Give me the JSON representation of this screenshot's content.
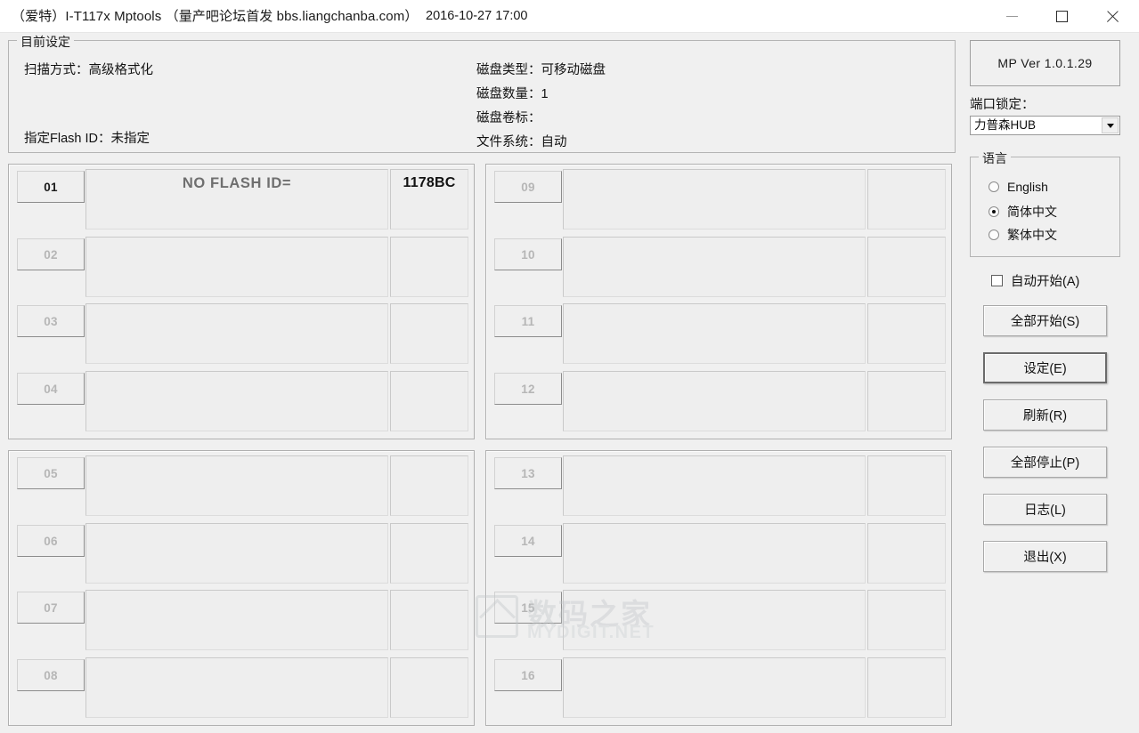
{
  "window": {
    "title": "（爱特）I-T117x Mptools （量产吧论坛首发 bbs.liangchanba.com）",
    "datetime": "2016-10-27 17:00",
    "controls": {
      "minimize": "minimize-icon",
      "maximize": "maximize-icon",
      "close": "close-icon"
    }
  },
  "settings": {
    "group_label": "目前设定",
    "scan_mode": "扫描方式：高级格式化",
    "flash_id": "指定Flash ID：未指定",
    "disk_type": "磁盘类型：可移动磁盘",
    "disk_count": "磁盘数量：1",
    "disk_label": "磁盘卷标：",
    "file_system": "文件系统：自动"
  },
  "slots": [
    {
      "num": "01",
      "status": "NO FLASH ID=",
      "extra": "1178BC",
      "active": true
    },
    {
      "num": "02",
      "status": "",
      "extra": "",
      "active": false
    },
    {
      "num": "03",
      "status": "",
      "extra": "",
      "active": false
    },
    {
      "num": "04",
      "status": "",
      "extra": "",
      "active": false
    },
    {
      "num": "05",
      "status": "",
      "extra": "",
      "active": false
    },
    {
      "num": "06",
      "status": "",
      "extra": "",
      "active": false
    },
    {
      "num": "07",
      "status": "",
      "extra": "",
      "active": false
    },
    {
      "num": "08",
      "status": "",
      "extra": "",
      "active": false
    },
    {
      "num": "09",
      "status": "",
      "extra": "",
      "active": false
    },
    {
      "num": "10",
      "status": "",
      "extra": "",
      "active": false
    },
    {
      "num": "11",
      "status": "",
      "extra": "",
      "active": false
    },
    {
      "num": "12",
      "status": "",
      "extra": "",
      "active": false
    },
    {
      "num": "13",
      "status": "",
      "extra": "",
      "active": false
    },
    {
      "num": "14",
      "status": "",
      "extra": "",
      "active": false
    },
    {
      "num": "15",
      "status": "",
      "extra": "",
      "active": false
    },
    {
      "num": "16",
      "status": "",
      "extra": "",
      "active": false
    }
  ],
  "sidebar": {
    "version": "MP Ver 1.0.1.29",
    "port_lock_label": "端口锁定：",
    "port_lock_value": "力普森HUB",
    "port_lock_options": [
      "力普森HUB"
    ],
    "language": {
      "group_label": "语言",
      "options": [
        {
          "label": "English",
          "selected": false
        },
        {
          "label": "简体中文",
          "selected": true
        },
        {
          "label": "繁体中文",
          "selected": false
        }
      ]
    },
    "auto_start": {
      "label": "自动开始(A)",
      "checked": false
    },
    "buttons": [
      {
        "label": "全部开始(S)",
        "focused": false
      },
      {
        "label": "设定(E)",
        "focused": true
      },
      {
        "label": "刷新(R)",
        "focused": false
      },
      {
        "label": "全部停止(P)",
        "focused": false
      },
      {
        "label": "日志(L)",
        "focused": false
      },
      {
        "label": "退出(X)",
        "focused": false
      }
    ]
  },
  "watermark": {
    "cn": "数码之家",
    "en": "MYDIGIT.NET"
  },
  "colors": {
    "window_bg": "#f0f0f0",
    "titlebar_bg": "#ffffff",
    "border": "#b4b4b4",
    "text": "#111111",
    "muted_text": "#b6b6b6",
    "status_text": "#6f6f6f"
  }
}
